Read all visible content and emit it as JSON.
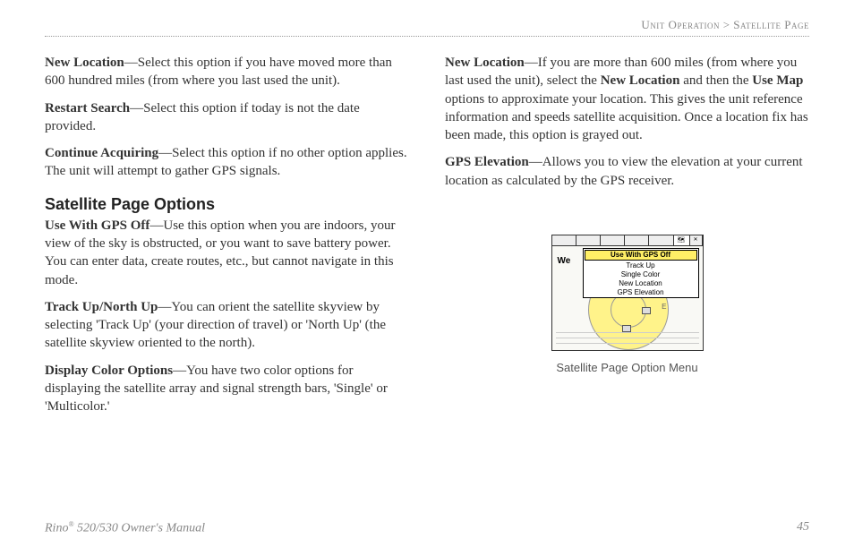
{
  "breadcrumb": {
    "section": "Unit Operation",
    "sep": " > ",
    "page": "Satellite Page"
  },
  "left": {
    "p1": {
      "bold": "New Location",
      "text": "—Select this option if you have moved more than 600 hundred miles (from where you last used the unit)."
    },
    "p2": {
      "bold": "Restart Search",
      "text": "—Select this option if today is not the date provided."
    },
    "p3": {
      "bold": "Continue Acquiring",
      "text": "—Select this option if no other option applies. The unit will attempt to gather GPS signals."
    },
    "heading": "Satellite Page Options",
    "p4": {
      "bold": "Use With GPS Off",
      "text": "—Use this option when you are indoors, your view of the sky is obstructed, or you want to save battery power. You can enter data, create routes, etc., but cannot navigate in this mode."
    },
    "p5": {
      "bold": "Track Up/North Up",
      "text": "—You can orient the satellite skyview by selecting 'Track Up' (your direction of travel) or 'North Up' (the satellite skyview oriented to the north)."
    },
    "p6": {
      "bold": "Display Color Options",
      "text": "—You have two color options for displaying the satellite array and signal strength bars, 'Single' or 'Multicolor.'"
    }
  },
  "right": {
    "p1": {
      "bold1": "New Location",
      "text1": "—If you are more than 600 miles (from where you last used the unit), select the ",
      "bold2": "New Location",
      "text2": " and then the ",
      "bold3": "Use Map",
      "text3": " options to approximate your location. This gives the unit reference information and speeds satellite acquisition. Once a location fix has been made, this option is grayed out."
    },
    "p2": {
      "bold": "GPS Elevation",
      "text": "—Allows you to view the elevation at your current location as calculated by the GPS receiver."
    }
  },
  "figure": {
    "menu": {
      "items": [
        "Use With GPS Off",
        "Track Up",
        "Single Color",
        "New Location",
        "GPS Elevation"
      ],
      "selected": 0
    },
    "we": "We",
    "dir_e": "E",
    "map_tab": "🗺",
    "close_tab": "✕",
    "caption": "Satellite Page Option Menu"
  },
  "footer": {
    "manual_prefix": "Rino",
    "manual_suffix": " 520/530 Owner's Manual",
    "page_number": "45"
  }
}
